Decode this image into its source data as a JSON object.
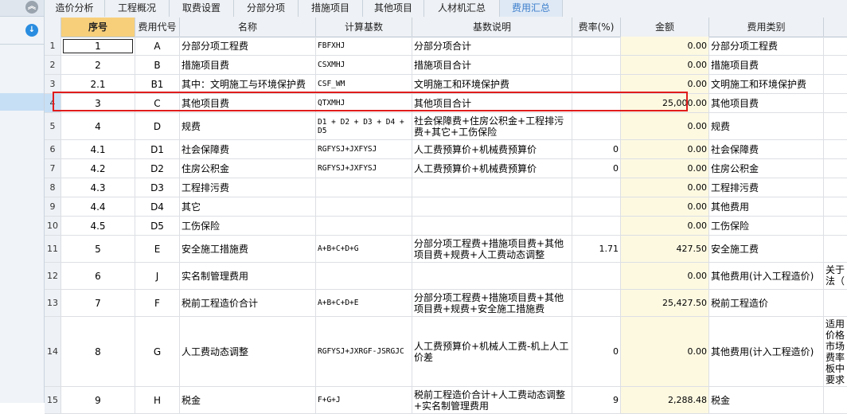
{
  "tabs": [
    {
      "label": "造价分析"
    },
    {
      "label": "工程概况"
    },
    {
      "label": "取费设置"
    },
    {
      "label": "分部分项"
    },
    {
      "label": "措施项目"
    },
    {
      "label": "其他项目"
    },
    {
      "label": "人材机汇总"
    },
    {
      "label": "费用汇总"
    }
  ],
  "active_tab": "费用汇总",
  "icons": {
    "collapse": "double-chevron-up-icon",
    "download": "down-arrow-circle-icon"
  },
  "colors": {
    "header_seq": "#f7cf7a",
    "amount_bg": "#fdf9e1",
    "active_tab": "#3e7fcc",
    "highlight": "#e01c1c"
  },
  "headers": {
    "seq": "序号",
    "code": "费用代号",
    "name": "名称",
    "base": "计算基数",
    "desc": "基数说明",
    "rate": "费率(%)",
    "amount": "金额",
    "type": "费用类别"
  },
  "rows": [
    {
      "rn": "1",
      "seq": "1",
      "code": "A",
      "name": "分部分项工程费",
      "base": "FBFXHJ",
      "desc": "分部分项合计",
      "rate": "",
      "amount": "0.00",
      "type": "分部分项工程费",
      "extra": ""
    },
    {
      "rn": "2",
      "seq": "2",
      "code": "B",
      "name": "措施项目费",
      "base": "CSXMHJ",
      "desc": "措施项目合计",
      "rate": "",
      "amount": "0.00",
      "type": "措施项目费",
      "extra": ""
    },
    {
      "rn": "3",
      "seq": "2.1",
      "code": "B1",
      "name": "其中：文明施工与环境保护费",
      "base": "CSF_WM",
      "desc": "文明施工和环境保护费",
      "rate": "",
      "amount": "0.00",
      "type": "文明施工和环境保护费",
      "extra": ""
    },
    {
      "rn": "4",
      "seq": "3",
      "code": "C",
      "name": "其他项目费",
      "base": "QTXMHJ",
      "desc": "其他项目合计",
      "rate": "",
      "amount": "25,000.00",
      "type": "其他项目费",
      "extra": ""
    },
    {
      "rn": "5",
      "seq": "4",
      "code": "D",
      "name": "规费",
      "base": "D1 + D2 + D3 + D4 + D5",
      "desc": "社会保障费+住房公积金+工程排污费+其它+工伤保险",
      "rate": "",
      "amount": "0.00",
      "type": "规费",
      "extra": ""
    },
    {
      "rn": "6",
      "seq": "4.1",
      "code": "D1",
      "name": "社会保障费",
      "base": "RGFYSJ+JXFYSJ",
      "desc": "人工费预算价+机械费预算价",
      "rate": "0",
      "amount": "0.00",
      "type": "社会保障费",
      "extra": ""
    },
    {
      "rn": "7",
      "seq": "4.2",
      "code": "D2",
      "name": "住房公积金",
      "base": "RGFYSJ+JXFYSJ",
      "desc": "人工费预算价+机械费预算价",
      "rate": "0",
      "amount": "0.00",
      "type": "住房公积金",
      "extra": ""
    },
    {
      "rn": "8",
      "seq": "4.3",
      "code": "D3",
      "name": "工程排污费",
      "base": "",
      "desc": "",
      "rate": "",
      "amount": "0.00",
      "type": "工程排污费",
      "extra": ""
    },
    {
      "rn": "9",
      "seq": "4.4",
      "code": "D4",
      "name": "其它",
      "base": "",
      "desc": "",
      "rate": "",
      "amount": "0.00",
      "type": "其他费用",
      "extra": ""
    },
    {
      "rn": "10",
      "seq": "4.5",
      "code": "D5",
      "name": "工伤保险",
      "base": "",
      "desc": "",
      "rate": "",
      "amount": "0.00",
      "type": "工伤保险",
      "extra": ""
    },
    {
      "rn": "11",
      "seq": "5",
      "code": "E",
      "name": "安全施工措施费",
      "base": "A+B+C+D+G",
      "desc": "分部分项工程费+措施项目费+其他项目费+规费+人工费动态调整",
      "rate": "1.71",
      "amount": "427.50",
      "type": "安全施工费",
      "extra": ""
    },
    {
      "rn": "12",
      "seq": "6",
      "code": "J",
      "name": "实名制管理费用",
      "base": "",
      "desc": "",
      "rate": "",
      "amount": "0.00",
      "type": "其他费用(计入工程造价)",
      "extra": "关于法（"
    },
    {
      "rn": "13",
      "seq": "7",
      "code": "F",
      "name": "税前工程造价合计",
      "base": "A+B+C+D+E",
      "desc": "分部分项工程费+措施项目费+其他项目费+规费+安全施工措施费",
      "rate": "",
      "amount": "25,427.50",
      "type": "税前工程造价",
      "extra": ""
    },
    {
      "rn": "14",
      "seq": "8",
      "code": "G",
      "name": "人工费动态调整",
      "base": "RGFYSJ+JXRGF-JSRGJC",
      "desc": "人工费预算价+机械人工费-机上人工价差",
      "rate": "0",
      "amount": "0.00",
      "type": "其他费用(计入工程造价)",
      "extra": "适用价格市场费率板中要求"
    },
    {
      "rn": "15",
      "seq": "9",
      "code": "H",
      "name": "税金",
      "base": "F+G+J",
      "desc": "税前工程造价合计+人工费动态调整+实名制管理费用",
      "rate": "9",
      "amount": "2,288.48",
      "type": "税金",
      "extra": ""
    }
  ]
}
